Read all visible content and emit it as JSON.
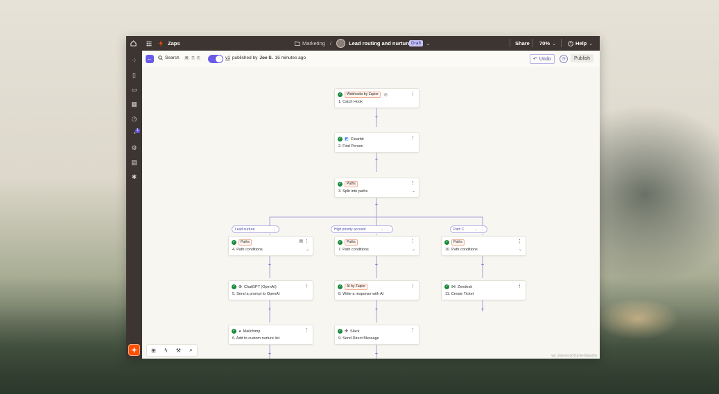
{
  "topbar": {
    "app_name": "Zaps",
    "breadcrumb_folder": "Marketing",
    "breadcrumb_sep": "/",
    "zap_name": "Lead routing and nurture",
    "status_badge": "Draft",
    "share_label": "Share",
    "zoom": "70%",
    "help_label": "Help"
  },
  "subbar": {
    "search_label": "Search",
    "shortcut_keys": [
      "⌘",
      "T",
      "F"
    ],
    "version_label": "v1",
    "published_text": "published by",
    "author": "Joe S.",
    "time_ago": "16 minutes ago",
    "undo_label": "Undo",
    "publish_label": "Publish"
  },
  "sidebar": {
    "notification_count": "1"
  },
  "steps": [
    {
      "app": "Webhooks by Zapier",
      "title": "1. Catch Hook"
    },
    {
      "app": "Clearbit",
      "title": "2. Find Person"
    },
    {
      "app": "Paths",
      "title": "3. Split into paths"
    },
    {
      "app": "Paths",
      "title": "4. Path conditions"
    },
    {
      "app": "Paths",
      "title": "7. Path conditions"
    },
    {
      "app": "Paths",
      "title": "10. Path conditions"
    },
    {
      "app": "ChatGPT (OpenAI)",
      "title": "5. Send a prompt to OpenAI"
    },
    {
      "app": "AI by Zapier",
      "title": "8. Write a response with AI"
    },
    {
      "app": "Zendesk",
      "title": "11. Create Ticket"
    },
    {
      "app": "Mailchimp",
      "title": "6. Add to custom nurture list"
    },
    {
      "app": "Slack",
      "title": "9. Send Direct Message"
    }
  ],
  "paths": [
    {
      "label": "Lead nurture"
    },
    {
      "label": "High priority account"
    },
    {
      "label": "Path C"
    }
  ],
  "footer": {
    "version_text": "ver. 2025-04-20T19:06-8f1ba7b4"
  },
  "colors": {
    "accent": "#695be8",
    "brand_orange": "#ff4f00",
    "chrome": "#3d3531",
    "success": "#1b8a3c"
  }
}
